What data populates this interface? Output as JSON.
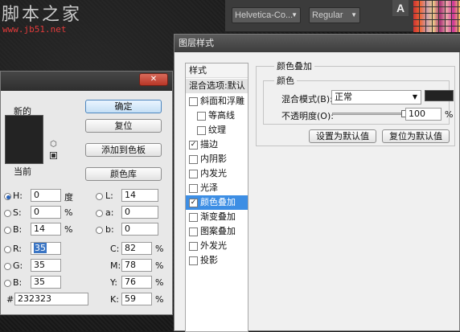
{
  "watermark": {
    "title": "脚本之家",
    "url": "www.jb51.net"
  },
  "toolbar": {
    "font_family": "Helvetica-Co...",
    "font_style": "Regular",
    "char_panel_label": "A"
  },
  "picker": {
    "new_label": "新的",
    "current_label": "当前",
    "new_color": "#232323",
    "current_color": "#232323",
    "buttons": {
      "ok": "确定",
      "reset": "复位",
      "add_swatch": "添加到色板",
      "libraries": "颜色库"
    },
    "hsb": [
      {
        "label": "H:",
        "value": "0",
        "unit": "度",
        "selected": true
      },
      {
        "label": "S:",
        "value": "0",
        "unit": "%"
      },
      {
        "label": "B:",
        "value": "14",
        "unit": "%"
      }
    ],
    "lab": [
      {
        "label": "L:",
        "value": "14"
      },
      {
        "label": "a:",
        "value": "0"
      },
      {
        "label": "b:",
        "value": "0"
      }
    ],
    "rgb": [
      {
        "label": "R:",
        "value": "35"
      },
      {
        "label": "G:",
        "value": "35"
      },
      {
        "label": "B:",
        "value": "35"
      }
    ],
    "cmyk": [
      {
        "label": "C:",
        "value": "82",
        "unit": "%"
      },
      {
        "label": "M:",
        "value": "78",
        "unit": "%"
      },
      {
        "label": "Y:",
        "value": "76",
        "unit": "%"
      },
      {
        "label": "K:",
        "value": "59",
        "unit": "%"
      }
    ],
    "hex_label": "#",
    "hex_value": "232323"
  },
  "layer_style": {
    "title": "图层样式",
    "list_header": "样式",
    "blend_options": "混合选项:默认",
    "items": [
      {
        "label": "斜面和浮雕",
        "checked": false,
        "indent": false
      },
      {
        "label": "等高线",
        "checked": false,
        "indent": true
      },
      {
        "label": "纹理",
        "checked": false,
        "indent": true
      },
      {
        "label": "描边",
        "checked": true,
        "indent": false
      },
      {
        "label": "内阴影",
        "checked": false,
        "indent": false
      },
      {
        "label": "内发光",
        "checked": false,
        "indent": false
      },
      {
        "label": "光泽",
        "checked": false,
        "indent": false
      },
      {
        "label": "颜色叠加",
        "checked": true,
        "indent": false,
        "selected": true
      },
      {
        "label": "渐变叠加",
        "checked": false,
        "indent": false
      },
      {
        "label": "图案叠加",
        "checked": false,
        "indent": false
      },
      {
        "label": "外发光",
        "checked": false,
        "indent": false
      },
      {
        "label": "投影",
        "checked": false,
        "indent": false
      }
    ],
    "panel_title": "颜色叠加",
    "group_title": "颜色",
    "blend_mode_label": "混合模式(B):",
    "blend_mode_value": "正常",
    "overlay_color": "#232323",
    "opacity_label": "不透明度(O):",
    "opacity_value": "100",
    "opacity_unit": "%",
    "opacity_fraction": 1.0,
    "set_default": "设置为默认值",
    "reset_default": "复位为默认值"
  }
}
